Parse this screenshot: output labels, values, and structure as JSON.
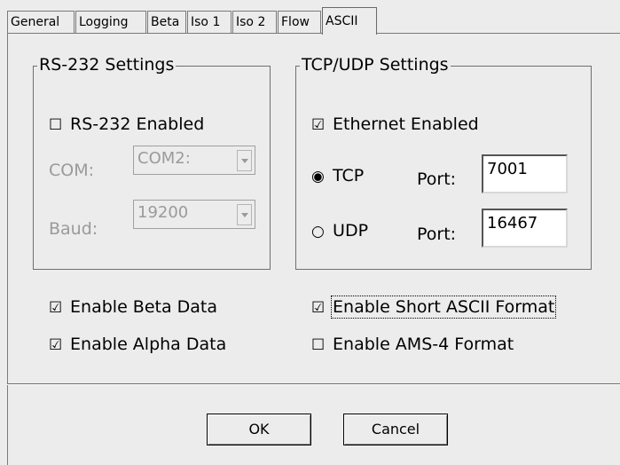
{
  "tabs": [
    "General",
    "Logging",
    "Beta",
    "Iso 1",
    "Iso 2",
    "Flow",
    "ASCII"
  ],
  "active_tab": "ASCII",
  "rs232": {
    "title": "RS-232 Settings",
    "enabled_label": "RS-232 Enabled",
    "enabled_checked": false,
    "com_label": "COM:",
    "com_value": "COM2:",
    "baud_label": "Baud:",
    "baud_value": "19200"
  },
  "tcpudp": {
    "title": "TCP/UDP Settings",
    "ethernet_label": "Ethernet Enabled",
    "ethernet_checked": true,
    "tcp_label": "TCP",
    "tcp_selected": true,
    "udp_label": "UDP",
    "udp_selected": false,
    "port_label": "Port:",
    "tcp_port": "7001",
    "udp_port": "16467"
  },
  "options": {
    "beta_label": "Enable Beta Data",
    "beta_checked": true,
    "alpha_label": "Enable Alpha Data",
    "alpha_checked": true,
    "short_ascii_label": "Enable Short ASCII Format",
    "short_ascii_checked": true,
    "ams4_label": "Enable AMS-4 Format",
    "ams4_checked": false
  },
  "buttons": {
    "ok": "OK",
    "cancel": "Cancel"
  },
  "glyphs": {
    "checked": "☑",
    "unchecked": "☐",
    "radio_on": "◉",
    "radio_off": "○"
  }
}
